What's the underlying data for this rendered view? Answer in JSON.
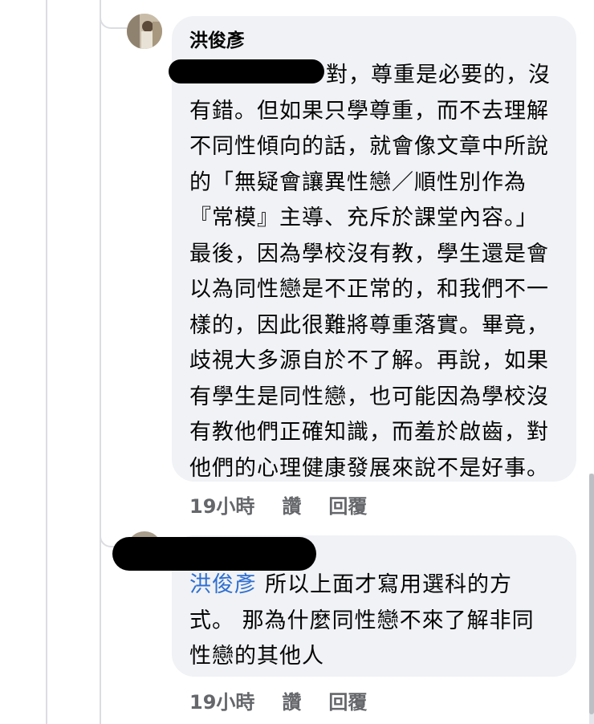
{
  "comments": [
    {
      "author": "洪俊彥",
      "text_lines": [
        "對，尊重是必要的，沒",
        "有錯。但如果只學尊重，而不去理解",
        "不同性傾向的話，就會像文章中所說",
        "的「無疑會讓異性戀／順性別作為",
        "『常模』主導、充斥於課堂內容。」",
        "最後，因為學校沒有教，學生還是會",
        "以為同性戀是不正常的，和我們不一",
        "樣的，因此很難將尊重落實。畢竟，",
        "歧視大多源自於不了解。再說，如果",
        "有學生是同性戀，也可能因為學校沒",
        "有教他們正確知識，而羞於啟齒，對",
        "他們的心理健康發展來說不是好事。"
      ],
      "time": "19小時",
      "like_label": "讚",
      "reply_label": "回覆"
    },
    {
      "mention": "洪俊彥",
      "text_lines": [
        "所以上面才寫用選科的方",
        "式。 那為什麼同性戀不來了解非同",
        "性戀的其他人"
      ],
      "time": "19小時",
      "like_label": "讚",
      "reply_label": "回覆"
    }
  ]
}
